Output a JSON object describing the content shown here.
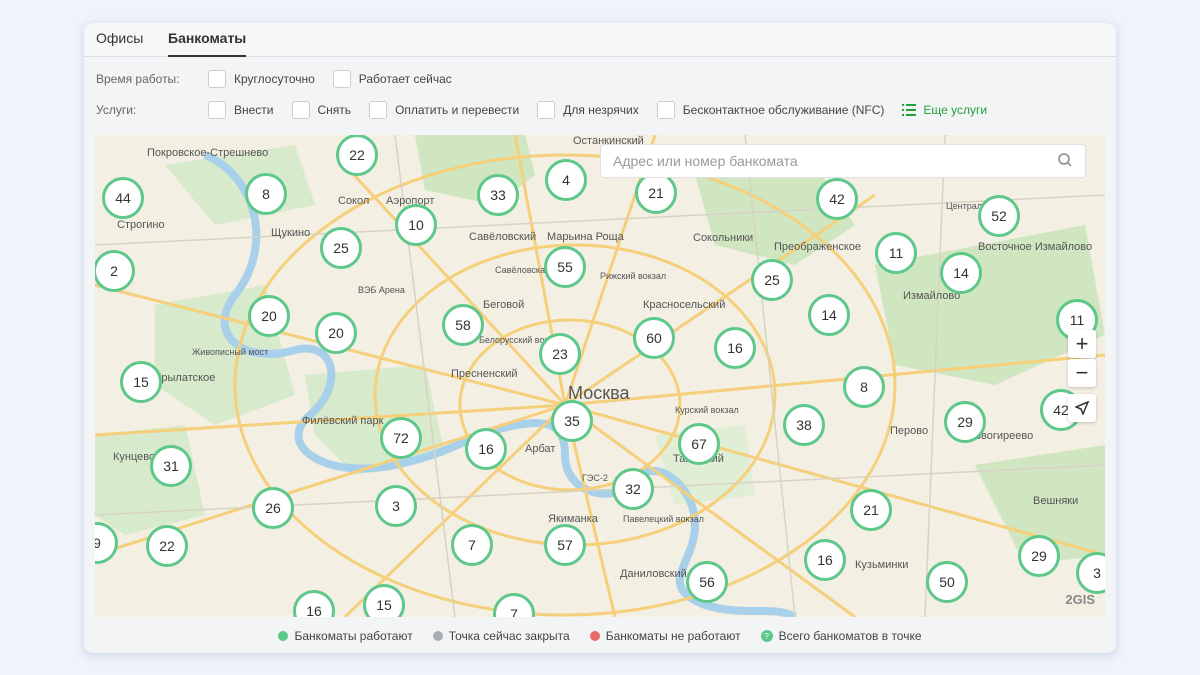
{
  "tabs": [
    {
      "label": "Офисы"
    },
    {
      "label": "Банкоматы"
    }
  ],
  "filters": {
    "hours_label": "Время работы:",
    "hours_options": [
      {
        "label": "Круглосуточно"
      },
      {
        "label": "Работает сейчас"
      }
    ],
    "services_label": "Услуги:",
    "services_options": [
      {
        "label": "Внести"
      },
      {
        "label": "Снять"
      },
      {
        "label": "Оплатить и перевести"
      },
      {
        "label": "Для незрячих"
      },
      {
        "label": "Бесконтактное обслуживание (NFC)"
      }
    ],
    "more_label": "Еще услуги"
  },
  "map": {
    "search_placeholder": "Адрес или номер банкомата",
    "city": "Москва",
    "places": [
      "Покровское-Стрешнево",
      "Строгино",
      "Щукино",
      "Сокол",
      "Аэропорт",
      "Савёловский",
      "Марьина Роща",
      "Останкинский",
      "Сокольники",
      "Преображенское",
      "Измайлово",
      "Восточное Измайлово",
      "Беговой",
      "Красносельский",
      "Пресненский",
      "Филёвский парк",
      "Крылатское",
      "Кунцево",
      "Арбат",
      "Таганский",
      "Якиманка",
      "Даниловский",
      "Перово",
      "Новогиреево",
      "Вешняки",
      "ВЭБ Арена",
      "Живописный мост",
      "Рижский вокзал",
      "Курский вокзал",
      "Павелецкий вокзал",
      "Белорусский вокзал",
      "ГЭС-2",
      "Савёловская",
      "Центральный",
      "Вешняки",
      "Кузьминки"
    ],
    "brand": "2GIS",
    "clusters": [
      {
        "count": "22"
      },
      {
        "count": "44"
      },
      {
        "count": "8"
      },
      {
        "count": "10"
      },
      {
        "count": "33"
      },
      {
        "count": "4"
      },
      {
        "count": "21"
      },
      {
        "count": "42"
      },
      {
        "count": "52"
      },
      {
        "count": "2"
      },
      {
        "count": "25"
      },
      {
        "count": "55"
      },
      {
        "count": "11"
      },
      {
        "count": "14"
      },
      {
        "count": "25"
      },
      {
        "count": "20"
      },
      {
        "count": "20"
      },
      {
        "count": "58"
      },
      {
        "count": "60"
      },
      {
        "count": "16"
      },
      {
        "count": "14"
      },
      {
        "count": "11"
      },
      {
        "count": "15"
      },
      {
        "count": "23"
      },
      {
        "count": "8"
      },
      {
        "count": "35"
      },
      {
        "count": "38"
      },
      {
        "count": "29"
      },
      {
        "count": "42"
      },
      {
        "count": "72"
      },
      {
        "count": "16"
      },
      {
        "count": "67"
      },
      {
        "count": "31"
      },
      {
        "count": "26"
      },
      {
        "count": "3"
      },
      {
        "count": "32"
      },
      {
        "count": "21"
      },
      {
        "count": "9"
      },
      {
        "count": "22"
      },
      {
        "count": "7"
      },
      {
        "count": "57"
      },
      {
        "count": "16"
      },
      {
        "count": "29"
      },
      {
        "count": "3"
      },
      {
        "count": "56"
      },
      {
        "count": "50"
      },
      {
        "count": "16"
      },
      {
        "count": "15"
      },
      {
        "count": "7"
      }
    ]
  },
  "legend": [
    {
      "label": "Банкоматы работают",
      "color": "#5ec88b"
    },
    {
      "label": "Точка сейчас закрыта",
      "color": "#a8abb1"
    },
    {
      "label": "Банкоматы не работают",
      "color": "#e86a6a"
    },
    {
      "label": "Всего банкоматов в точке",
      "color": "#5ec88b",
      "icon": "?"
    }
  ]
}
